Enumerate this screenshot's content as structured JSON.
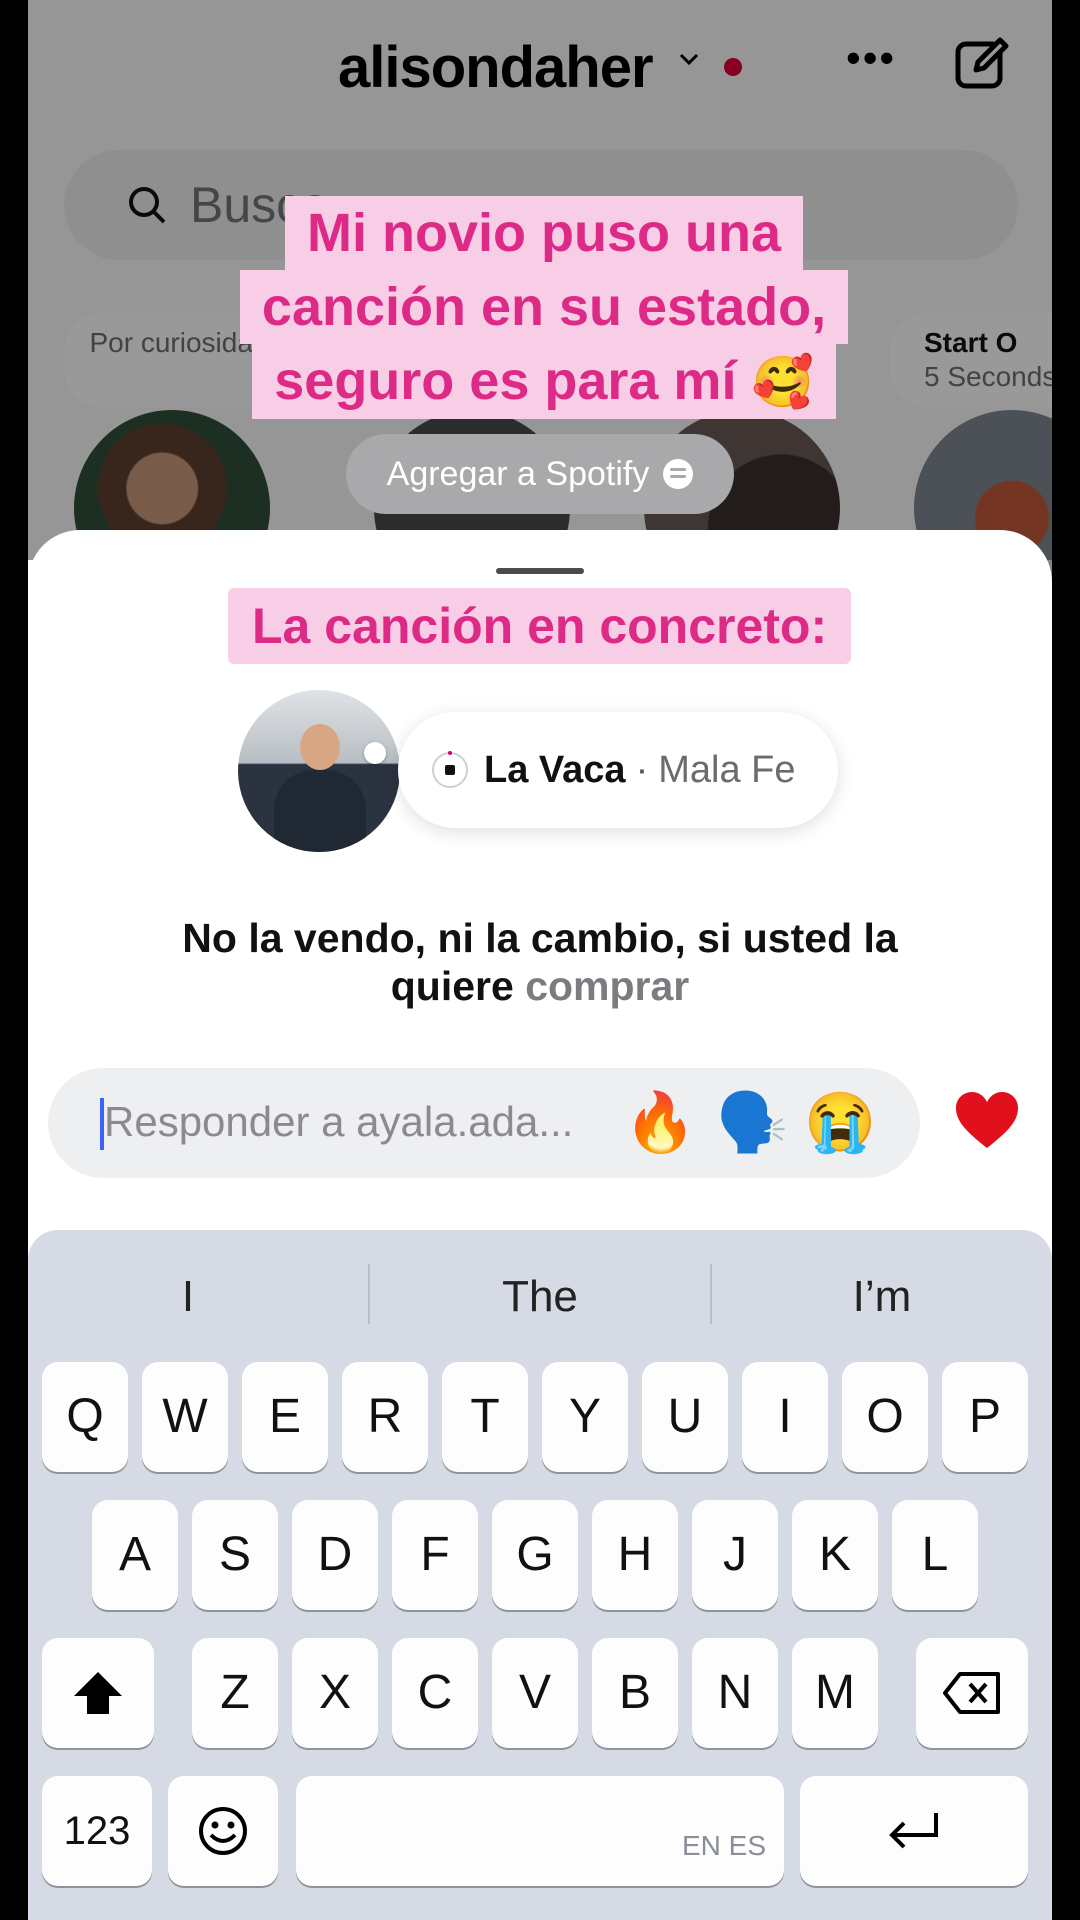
{
  "header": {
    "username": "alisondaher",
    "search_placeholder": "Busca",
    "note_left_text": "Por curiosidad",
    "note_right_title": "Start O",
    "note_right_sub": "5 Seconds"
  },
  "overlay_captions": {
    "line1": "Mi novio puso una",
    "line2": "canción en su estado,",
    "line3": "seguro es para mí",
    "line3_emoji": "🥰",
    "spotify_button": "Agregar a Spotify",
    "heading": "La canción en concreto:"
  },
  "note": {
    "song_title": "La Vaca",
    "separator": "·",
    "artist": "Mala Fe",
    "lyric_main": "No la vendo, ni la cambio, si usted la quiere",
    "lyric_next": "comprar"
  },
  "reply": {
    "placeholder": "Responder a ayala.ada...",
    "quick_emojis": [
      "🔥",
      "🗣️",
      "😭"
    ]
  },
  "keyboard": {
    "suggestions": [
      "I",
      "The",
      "I’m"
    ],
    "row1": [
      "Q",
      "W",
      "E",
      "R",
      "T",
      "Y",
      "U",
      "I",
      "O",
      "P"
    ],
    "row2": [
      "A",
      "S",
      "D",
      "F",
      "G",
      "H",
      "J",
      "K",
      "L"
    ],
    "row3": [
      "Z",
      "X",
      "C",
      "V",
      "B",
      "N",
      "M"
    ],
    "numbers_label": "123",
    "emoji_label": "☺",
    "space_langs": "EN ES"
  },
  "colors": {
    "caption_pink_bg": "#f8cde6",
    "caption_pink_text": "#dd2a87",
    "heart_red": "#e0101d",
    "caret_blue": "#3b63ff"
  }
}
